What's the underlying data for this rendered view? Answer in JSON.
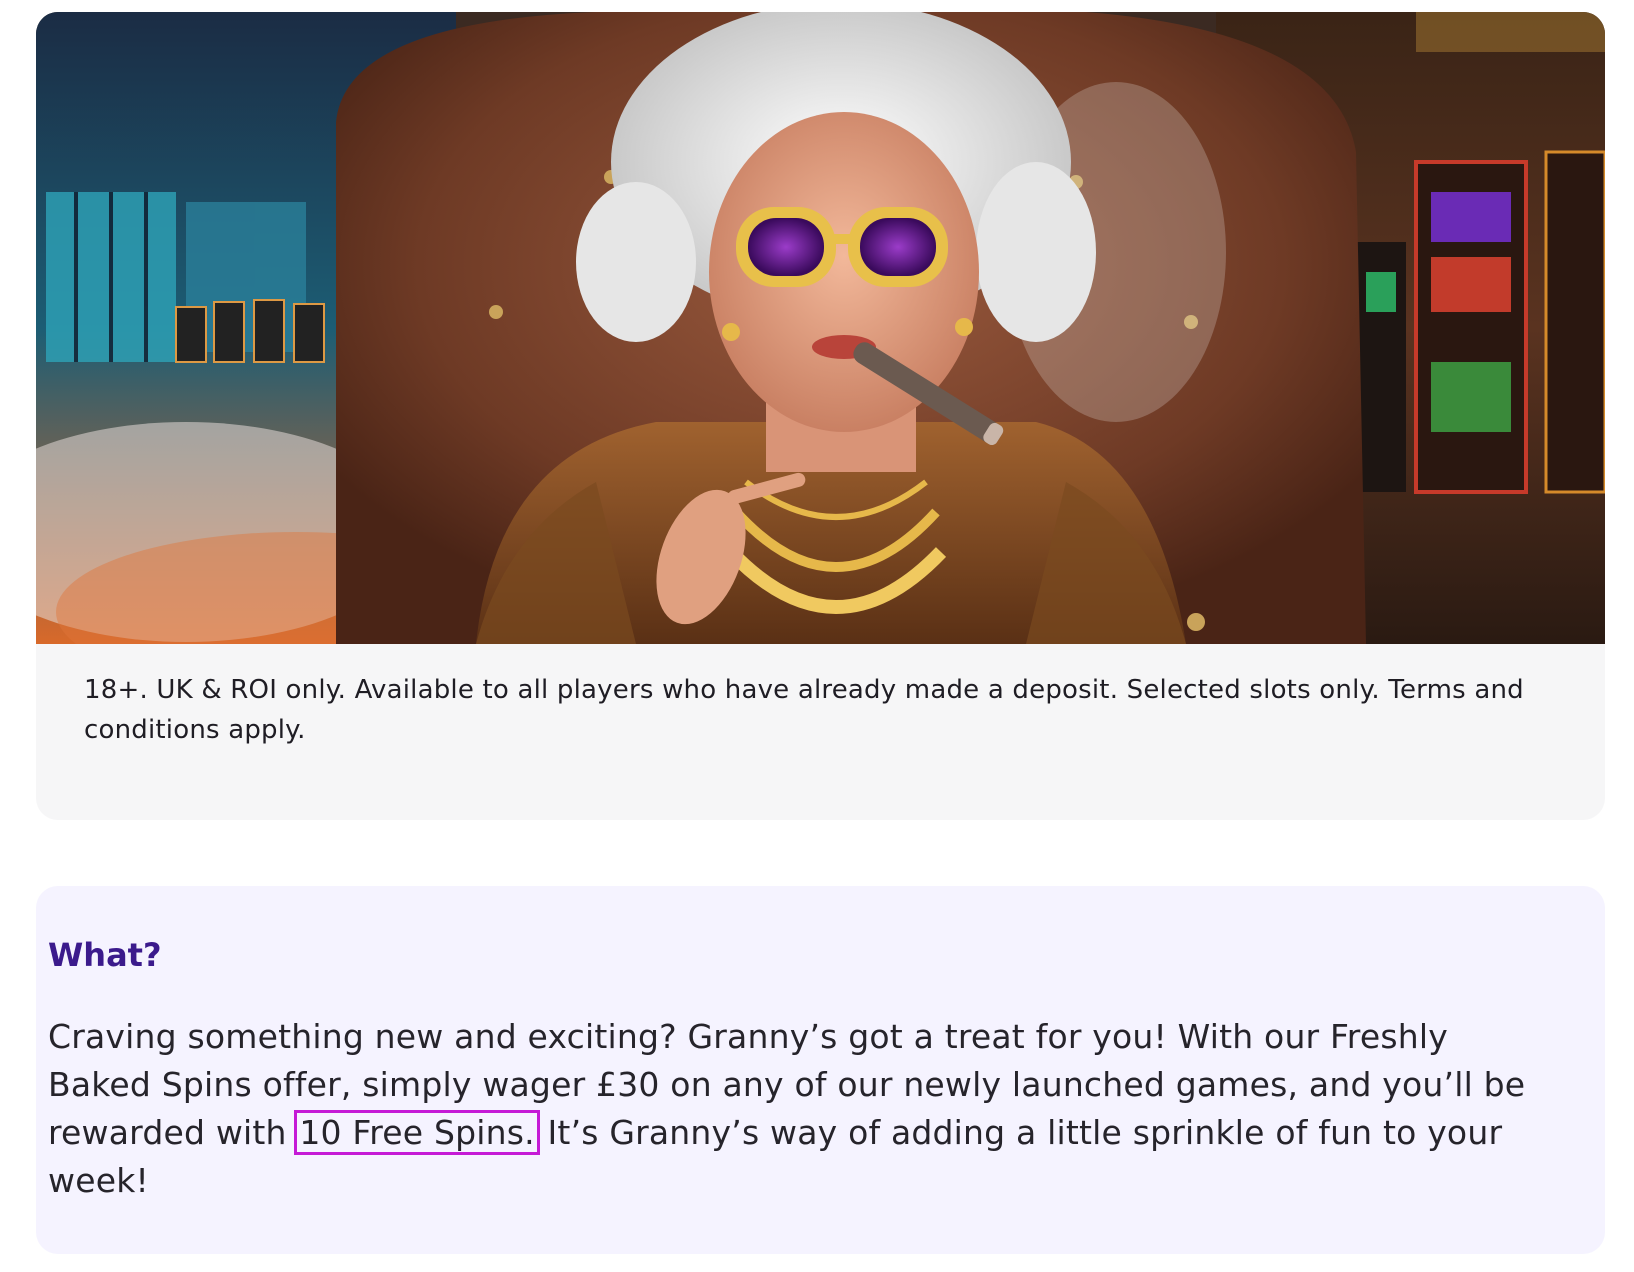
{
  "hero": {
    "image_alt": "Granny with gold sunglasses and cigar sitting in a leather chair in a casino",
    "icon": "hero-banner-image"
  },
  "terms": {
    "text": "18+. UK & ROI only. Available to all players who have already made a deposit. Selected slots only. Terms and conditions apply."
  },
  "info": {
    "heading": "What?",
    "body_before": "Craving something new and exciting? Granny’s got a treat for you! With our Freshly Baked Spins offer, simply wager £30 on any of our newly launched games, and you’ll be rewarded with ",
    "highlight": "10 Free Spins.",
    "body_after": " It’s Granny’s way of adding a little sprinkle of fun to your week!"
  },
  "colors": {
    "heading": "#3b1a8c",
    "highlight_border": "#c51ad6",
    "info_bg": "#f5f3ff",
    "terms_bg": "#f6f6f7"
  }
}
